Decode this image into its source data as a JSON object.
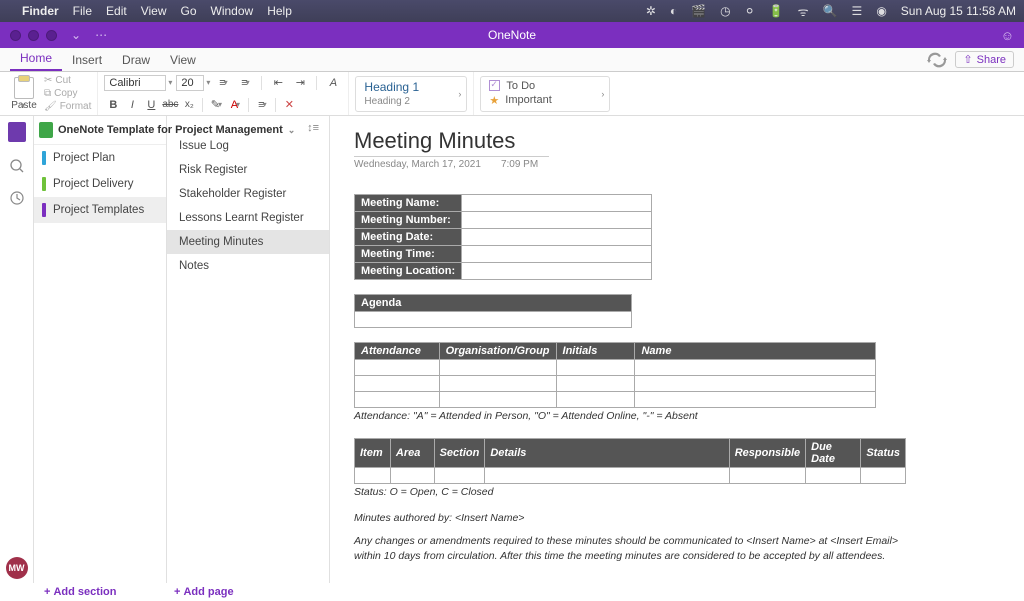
{
  "menubar": {
    "app": "Finder",
    "items": [
      "File",
      "Edit",
      "View",
      "Go",
      "Window",
      "Help"
    ],
    "clock": "Sun Aug 15  11:58 AM"
  },
  "titlebar": {
    "title": "OneNote"
  },
  "tabs": {
    "items": [
      "Home",
      "Insert",
      "Draw",
      "View"
    ],
    "active": 0,
    "share": "Share"
  },
  "ribbon": {
    "paste": "Paste",
    "cut": "Cut",
    "copy": "Copy",
    "format": "Format",
    "font": "Calibri",
    "size": "20",
    "heading1": "Heading 1",
    "heading2": "Heading 2",
    "todo": "To Do",
    "important": "Important"
  },
  "notebook": {
    "name": "OneNote Template for Project Management",
    "sections": [
      {
        "label": "Project Plan",
        "color": "#2fa4d8"
      },
      {
        "label": "Project Delivery",
        "color": "#6fc23a"
      },
      {
        "label": "Project Templates",
        "color": "#7b2fbf"
      }
    ],
    "active_section": 2
  },
  "pages": {
    "items": [
      "Issue Log",
      "Risk Register",
      "Stakeholder Register",
      "Lessons Learnt Register",
      "Meeting Minutes",
      "Notes"
    ],
    "active": 4
  },
  "content": {
    "title": "Meeting Minutes",
    "date": "Wednesday, March 17, 2021",
    "time": "7:09 PM",
    "meeting_fields": [
      "Meeting Name:",
      "Meeting Number:",
      "Meeting Date:",
      "Meeting Time:",
      "Meeting Location:"
    ],
    "agenda_header": "Agenda",
    "attendance_headers": [
      "Attendance",
      "Organisation/Group",
      "Initials",
      "Name"
    ],
    "attendance_legend": "Attendance: \"A\" = Attended in Person, \"O\" = Attended Online, \"-\" = Absent",
    "items_headers": [
      "Item",
      "Area",
      "Section",
      "Details",
      "Responsible",
      "Due Date",
      "Status"
    ],
    "status_note": "Status: O = Open, C = Closed",
    "authored": "Minutes authored by: <Insert Name>",
    "disclaimer": "Any changes or amendments required to these minutes should be communicated to <Insert Name> at <Insert Email> within 10 days from circulation. After this time the meeting minutes are considered to be accepted by all attendees."
  },
  "bottom": {
    "add_section": "Add section",
    "add_page": "Add page"
  },
  "avatar": "MW"
}
